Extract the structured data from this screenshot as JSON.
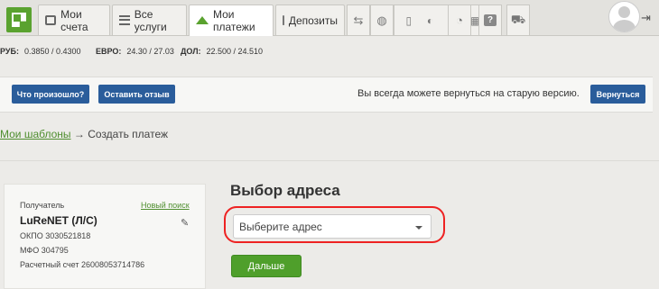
{
  "nav": {
    "tabs": [
      {
        "label": "Мои счета",
        "icon": "card-icon"
      },
      {
        "label": "Все услуги",
        "icon": "list-icon"
      },
      {
        "label": "Мои платежи",
        "icon": "home-icon"
      },
      {
        "label": "Депозиты",
        "icon": "piggy-bank-icon"
      }
    ],
    "icon_buttons": [
      "transport-icon",
      "sports-ball-icon",
      "mobile-apps-icon",
      "history-icon",
      "help-icon",
      "cart-icon"
    ],
    "help_glyph": "?"
  },
  "rates": [
    {
      "currency": "РУБ:",
      "value": "0.3850 / 0.4300"
    },
    {
      "currency": "ЕВРО:",
      "value": "24.30 / 27.03"
    },
    {
      "currency": "ДОЛ:",
      "value": "22.500 / 24.510"
    }
  ],
  "notice": {
    "what_happened": "Что произошло?",
    "leave_feedback": "Оставить отзыв",
    "text": "Вы всегда можете вернуться на старую версию.",
    "return": "Вернуться"
  },
  "breadcrumb": {
    "link": "Мои шаблоны",
    "arrow": "→",
    "current": "Создать платеж"
  },
  "recipient": {
    "label": "Получатель",
    "new_search": "Новый поиск",
    "name": "LuReNET (Л/С)",
    "okpo": "ОКПО 3030521818",
    "mfo": "МФО 304795",
    "account": "Расчетный счет 26008053714786"
  },
  "address": {
    "title": "Выбор адреса",
    "placeholder": "Выберите адрес",
    "next": "Дальше"
  },
  "colors": {
    "accent_green": "#4f9f2b",
    "button_blue": "#2a5d9b",
    "highlight_red": "#e22"
  }
}
